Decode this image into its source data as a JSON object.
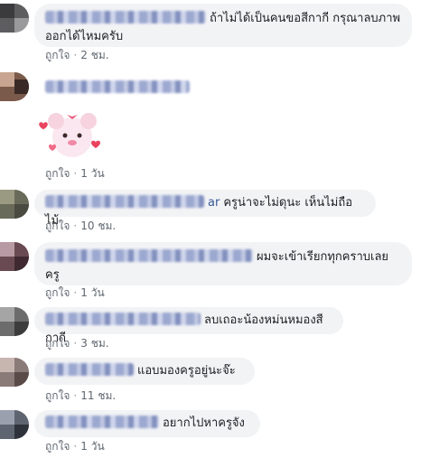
{
  "comments": [
    {
      "text": "ถ้าไม่ได้เป็นคนขอสีกากี กรุณาลบภาพออกได้ไหมครับ",
      "like": "ถูกใจ",
      "time": "2 ชม."
    },
    {
      "text": "",
      "like": "ถูกใจ",
      "time": "1 วัน",
      "sticker": "pink-bear-sticker"
    },
    {
      "text": "ครูน่าจะไม่ดุนะ เห็นไม่ถือไม้",
      "name_tail": "ar",
      "like": "ถูกใจ",
      "time": "10 ชม."
    },
    {
      "text": "ผมจะเข้าเรียกทุกคราบเลยครู",
      "like": "ถูกใจ",
      "time": "1 วัน"
    },
    {
      "text": "ลบเถอะน้องหม่นหมองสีกากี",
      "like": "ถูกใจ",
      "time": "3 ชม."
    },
    {
      "text": "แอบมองครูอยู่นะจ๊ะ",
      "like": "ถูกใจ",
      "time": "11 ชม."
    },
    {
      "text": "อยากไปหาครูจัง",
      "like": "ถูกใจ",
      "time": "1 วัน"
    }
  ],
  "colors": {
    "bubble": "#f2f3f5",
    "meta": "#606770",
    "text": "#1c1e21"
  }
}
